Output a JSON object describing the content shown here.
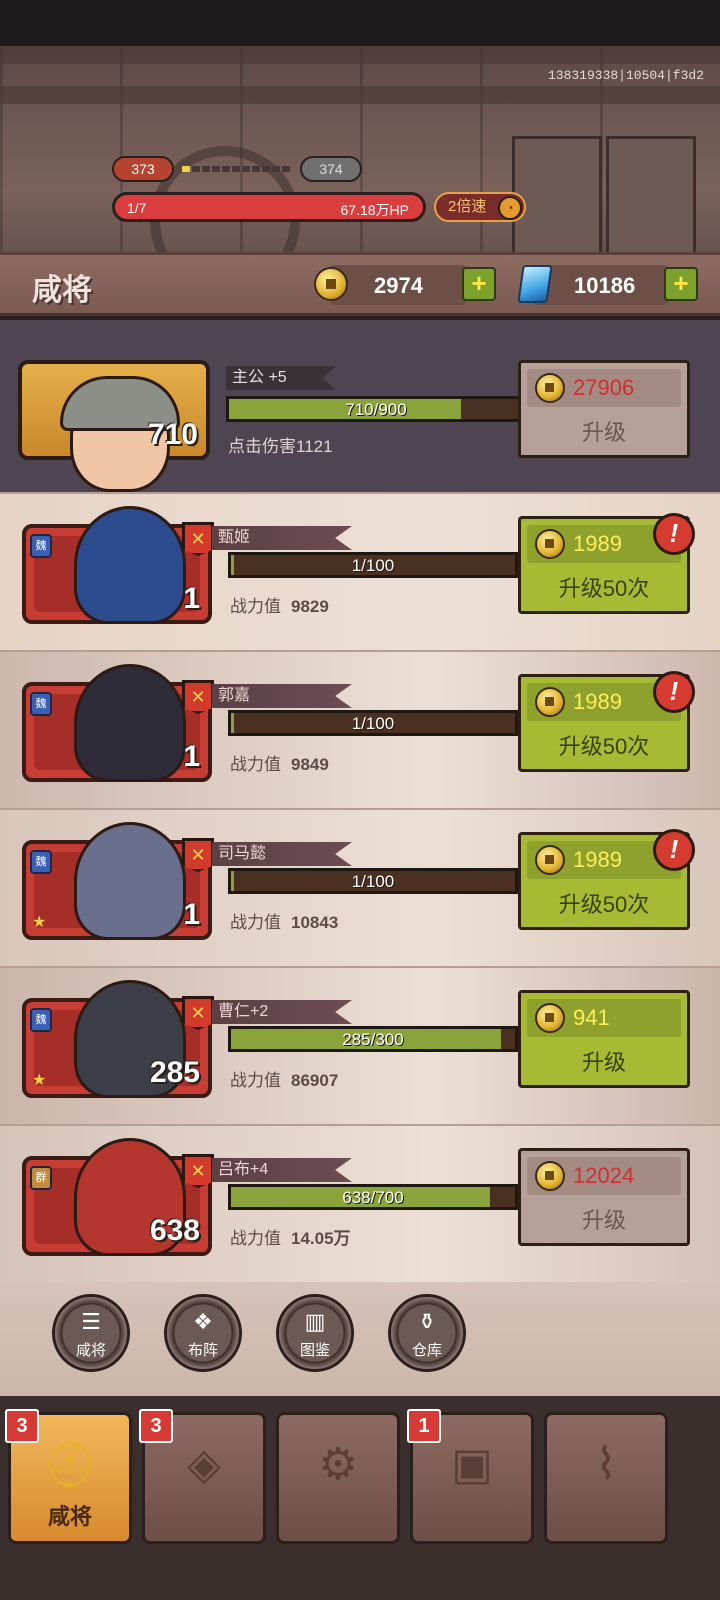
{
  "server_id": "138319338|10504|f3d2",
  "stage": {
    "current_level": "373",
    "next_level": "374",
    "wave": "1/7",
    "boss_hp": "67.18万HP",
    "speed_label": "2倍速",
    "stage_progress_pct": 10
  },
  "header": {
    "title": "咸将",
    "gold": "2974",
    "gems": "10186"
  },
  "lord": {
    "name": "主公 +5",
    "level": "710",
    "exp": "710/900",
    "exp_fraction": 0.789,
    "stat": "点击伤害1121",
    "upgrade_cost": "27906",
    "upgrade_label": "升级",
    "affordable": false
  },
  "heroes": [
    {
      "name": "甄姬",
      "faction": "魏",
      "level": "1",
      "exp": "1/100",
      "exp_fraction": 0.01,
      "stat_label": "战力值",
      "power": "9829",
      "cost": "1989",
      "upgrade_label": "升级50次",
      "affordable": true,
      "alert": true,
      "star": false
    },
    {
      "name": "郭嘉",
      "faction": "魏",
      "level": "1",
      "exp": "1/100",
      "exp_fraction": 0.01,
      "stat_label": "战力值",
      "power": "9849",
      "cost": "1989",
      "upgrade_label": "升级50次",
      "affordable": true,
      "alert": true,
      "star": false
    },
    {
      "name": "司马懿",
      "faction": "魏",
      "level": "1",
      "exp": "1/100",
      "exp_fraction": 0.01,
      "stat_label": "战力值",
      "power": "10843",
      "cost": "1989",
      "upgrade_label": "升级50次",
      "affordable": true,
      "alert": true,
      "star": true
    },
    {
      "name": "曹仁+2",
      "faction": "魏",
      "level": "285",
      "exp": "285/300",
      "exp_fraction": 0.95,
      "stat_label": "战力值",
      "power": "86907",
      "cost": "941",
      "upgrade_label": "升级",
      "affordable": true,
      "alert": false,
      "star": true
    },
    {
      "name": "吕布+4",
      "faction": "群",
      "level": "638",
      "exp": "638/700",
      "exp_fraction": 0.911,
      "stat_label": "战力值",
      "power": "14.05万",
      "cost": "12024",
      "upgrade_label": "升级",
      "affordable": false,
      "alert": false,
      "star": false
    }
  ],
  "quick_buttons": [
    {
      "label": "咸将",
      "icon": "list-icon"
    },
    {
      "label": "布阵",
      "icon": "formation-icon"
    },
    {
      "label": "图鉴",
      "icon": "book-icon"
    },
    {
      "label": "仓库",
      "icon": "bag-icon"
    }
  ],
  "bottom_tabs": [
    {
      "label": "咸将",
      "badge": "3",
      "icon": "helmet-icon",
      "active": true
    },
    {
      "label": "",
      "badge": "3",
      "icon": "armor-icon",
      "active": false
    },
    {
      "label": "",
      "badge": "",
      "icon": "pot-icon",
      "active": false
    },
    {
      "label": "",
      "badge": "1",
      "icon": "chest-icon",
      "active": false
    },
    {
      "label": "",
      "badge": "",
      "icon": "map-icon",
      "active": false
    }
  ],
  "colors": {
    "gold_accent": "#f0d24a",
    "hp_red": "#d93d3d",
    "affordable_green": "#a7ba34",
    "unaffordable_gray": "#b5a19a",
    "exp_fill": "#8aa33a"
  }
}
